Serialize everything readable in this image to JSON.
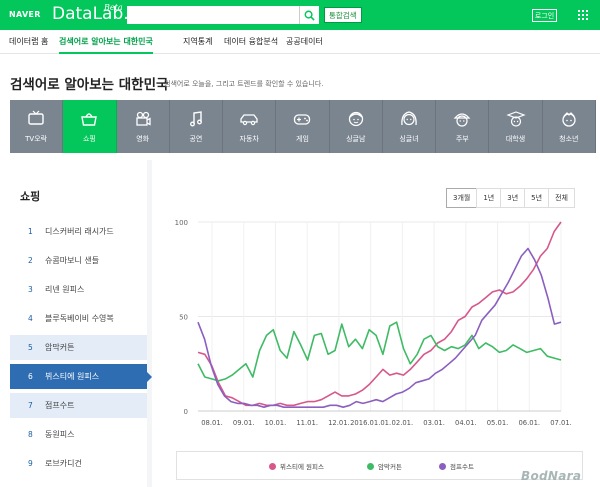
{
  "header": {
    "naver": "NAVER",
    "datalab": "DataLab.",
    "beta": "Beta",
    "search_placeholder": "",
    "total_search": "통합검색",
    "login": "로그인"
  },
  "nav": [
    {
      "label": "데이터랩 홈"
    },
    {
      "label": "검색어로 알아보는 대한민국"
    },
    {
      "label": "지역통계"
    },
    {
      "label": "데이터 융합분석"
    },
    {
      "label": "공공데이터"
    }
  ],
  "page": {
    "title": "검색어로 알아보는 대한민국",
    "subtitle": "검색어로 오늘을, 그리고 트렌드를 확인할 수 있습니다."
  },
  "categories": [
    {
      "label": "TV오락",
      "icon": "tv-icon"
    },
    {
      "label": "쇼핑",
      "icon": "shopping-basket-icon"
    },
    {
      "label": "영화",
      "icon": "film-camera-icon"
    },
    {
      "label": "공연",
      "icon": "music-note-icon"
    },
    {
      "label": "자동차",
      "icon": "car-icon"
    },
    {
      "label": "게임",
      "icon": "gamepad-icon"
    },
    {
      "label": "싱글남",
      "icon": "single-man-icon"
    },
    {
      "label": "싱글녀",
      "icon": "single-woman-icon"
    },
    {
      "label": "주부",
      "icon": "housewife-icon"
    },
    {
      "label": "대학생",
      "icon": "student-icon"
    },
    {
      "label": "청소년",
      "icon": "teen-icon"
    }
  ],
  "list": {
    "title": "쇼핑",
    "items": [
      {
        "num": "1",
        "label": "디스커버리 래시가드"
      },
      {
        "num": "2",
        "label": "슈콤마보니 샌들"
      },
      {
        "num": "3",
        "label": "리넨 원피스"
      },
      {
        "num": "4",
        "label": "블루독베이비 수영복"
      },
      {
        "num": "5",
        "label": "암막커튼"
      },
      {
        "num": "6",
        "label": "뷔스티에 원피스"
      },
      {
        "num": "7",
        "label": "점프수트"
      },
      {
        "num": "8",
        "label": "동원피스"
      },
      {
        "num": "9",
        "label": "로브카디건"
      }
    ]
  },
  "ranges": [
    "3개월",
    "1년",
    "3년",
    "5년",
    "전체"
  ],
  "chart_data": {
    "type": "line",
    "x": [
      "08.01.",
      "09.01.",
      "10.01.",
      "11.01.",
      "12.01.",
      "2016.01.01.",
      "02.01.",
      "03.01.",
      "04.01.",
      "05.01.",
      "06.01.",
      "07.01."
    ],
    "ylim": [
      0,
      100
    ],
    "yticks": [
      "0",
      "50",
      "100"
    ],
    "grid": true,
    "legend": "bottom",
    "series": [
      {
        "name": "뷔스티에 원피스",
        "color": "#d6588a",
        "values": [
          31,
          30,
          24,
          15,
          8,
          7,
          5,
          3,
          3,
          4,
          3,
          3,
          4,
          3,
          3,
          4,
          5,
          5,
          6,
          8,
          10,
          8,
          8,
          9,
          11,
          14,
          18,
          22,
          19,
          20,
          19,
          22,
          26,
          30,
          32,
          36,
          38,
          42,
          48,
          50,
          55,
          57,
          60,
          63,
          64,
          62,
          63,
          66,
          70,
          75,
          82,
          86,
          95,
          100
        ]
      },
      {
        "name": "암막커튼",
        "color": "#3fbb65",
        "values": [
          25,
          18,
          17,
          16,
          17,
          19,
          22,
          25,
          18,
          32,
          40,
          43,
          32,
          28,
          42,
          35,
          27,
          40,
          41,
          30,
          32,
          46,
          34,
          38,
          33,
          43,
          40,
          30,
          45,
          47,
          33,
          25,
          30,
          38,
          40,
          34,
          32,
          34,
          33,
          35,
          40,
          33,
          36,
          34,
          31,
          32,
          35,
          33,
          31,
          32,
          33,
          29,
          28,
          27
        ]
      },
      {
        "name": "점프수트",
        "color": "#8a5fc0",
        "values": [
          47,
          38,
          24,
          14,
          8,
          5,
          4,
          4,
          3,
          3,
          2,
          3,
          3,
          2,
          2,
          2,
          2,
          2,
          2,
          2,
          3,
          3,
          2,
          3,
          5,
          4,
          5,
          6,
          5,
          7,
          9,
          10,
          12,
          15,
          16,
          17,
          20,
          22,
          25,
          28,
          32,
          36,
          40,
          48,
          52,
          56,
          62,
          68,
          75,
          82,
          86,
          80,
          72,
          60,
          46,
          47
        ]
      }
    ]
  },
  "watermark": "BodNara"
}
